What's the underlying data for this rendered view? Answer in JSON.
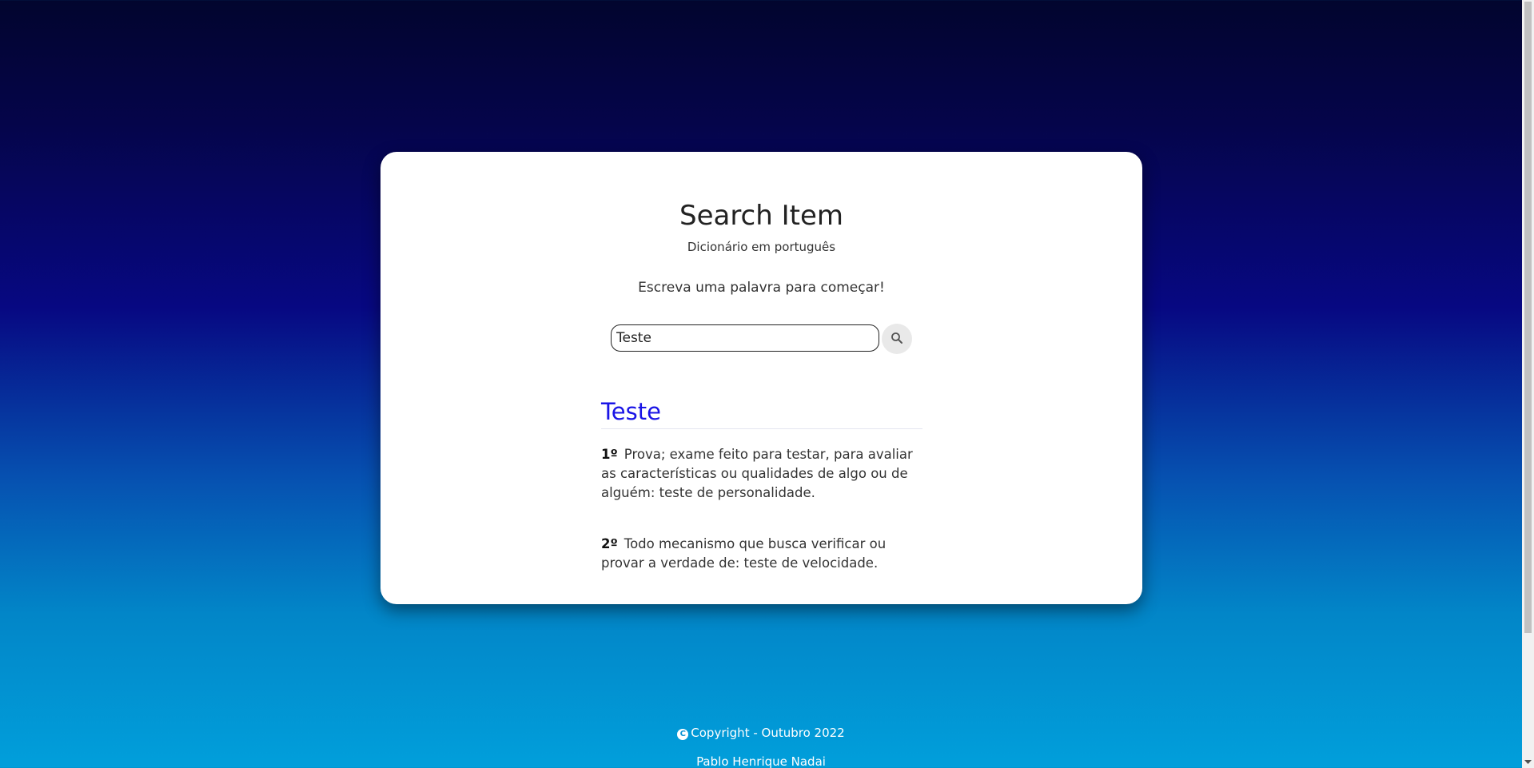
{
  "header": {
    "title": "Search Item",
    "subtitle": "Dicionário em português",
    "prompt": "Escreva uma palavra para começar!"
  },
  "search": {
    "value": "Teste",
    "button_icon": "search-icon"
  },
  "result": {
    "word": "Teste",
    "definitions": [
      {
        "num": "1º",
        "text": "Prova; exame feito para testar, para avaliar as características ou qualidades de algo ou de alguém: teste de personalidade."
      },
      {
        "num": "2º",
        "text": "Todo mecanismo que busca verificar ou provar a verdade de: teste de velocidade."
      }
    ]
  },
  "footer": {
    "copyright_icon": "copyright-icon",
    "copyright_symbol": "C",
    "copyright": "Copyright - Outubro 2022",
    "author": "Pablo Henrique Nadai"
  },
  "colors": {
    "accent_word": "#1a14e6",
    "background_top": "#02052e",
    "background_bottom": "#019fdb"
  }
}
